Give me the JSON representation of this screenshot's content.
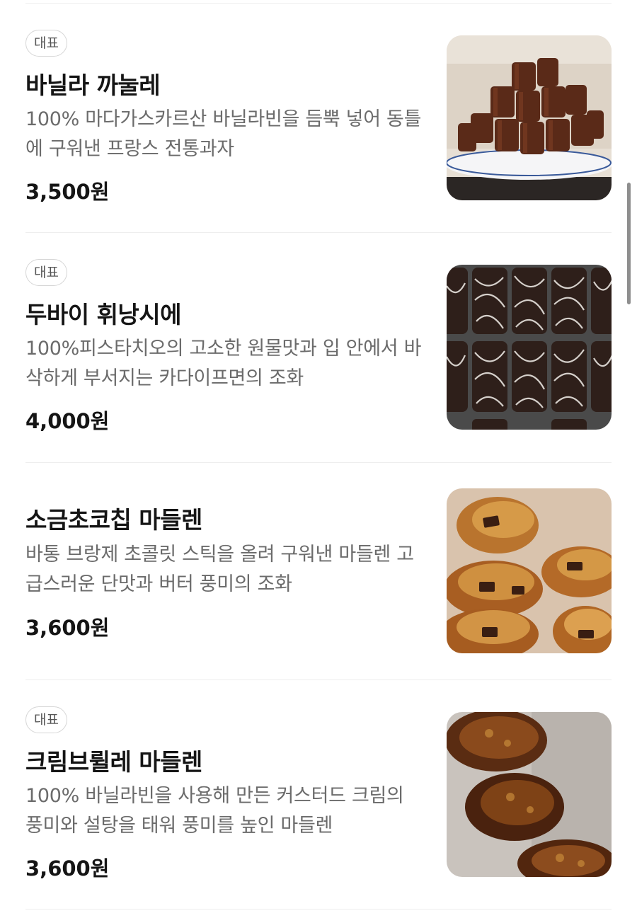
{
  "menu": {
    "items": [
      {
        "badge": "대표",
        "name": "바닐라 까눌레",
        "description": "100% 마다가스카르산 바닐라빈을 듬뿍 넣어 동틀에 구워낸 프랑스 전통과자",
        "price": "3,500원",
        "image": "canele-photo"
      },
      {
        "badge": "대표",
        "name": "두바이 휘낭시에",
        "description": "100%피스타치오의 고소한 원물맛과 입 안에서 바삭하게 부서지는 카다이프면의 조화",
        "price": "4,000원",
        "image": "dubai-financier-photo"
      },
      {
        "name": "소금초코칩 마들렌",
        "description": "바통 브랑제 초콜릿 스틱을 올려 구워낸 마들렌 고급스러운 단맛과 버터 풍미의 조화",
        "price": "3,600원",
        "image": "salt-chocochip-madeleine-photo"
      },
      {
        "badge": "대표",
        "name": "크림브륄레 마들렌",
        "description": "100% 바닐라빈을 사용해 만든 커스터드 크림의 풍미와 설탕을 태워 풍미를 높인 마들렌",
        "price": "3,600원",
        "image": "creme-brulee-madeleine-photo"
      }
    ]
  }
}
